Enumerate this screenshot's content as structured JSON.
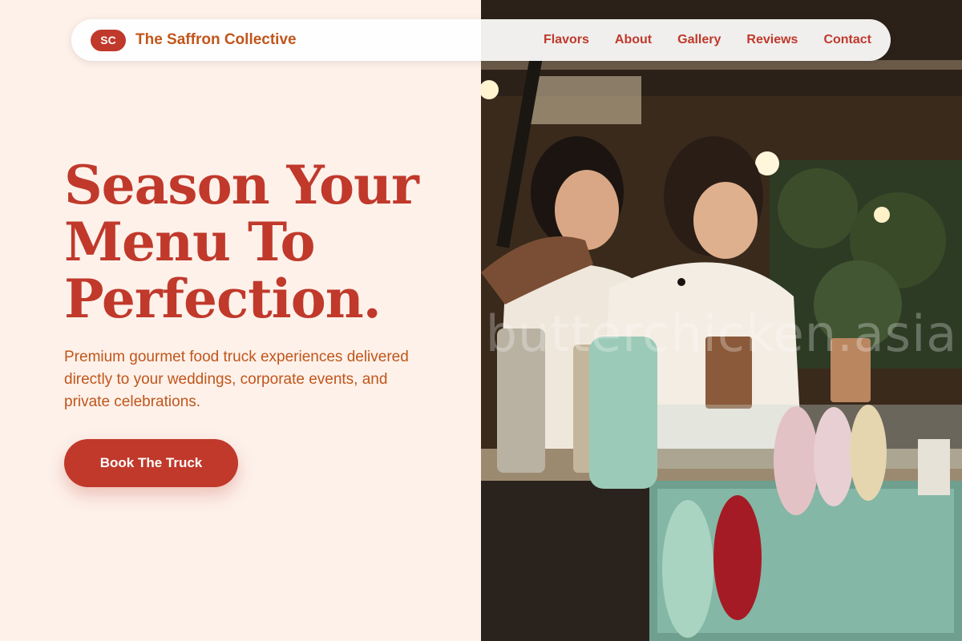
{
  "brand": {
    "logo_text": "SC",
    "name": "The Saffron Collective",
    "accent": "#c0392b",
    "name_color": "#c0561b"
  },
  "nav": {
    "links": [
      "Flavors",
      "About",
      "Gallery",
      "Reviews",
      "Contact"
    ]
  },
  "hero": {
    "title_lines": [
      "Season Your",
      "Menu To",
      "Perfection."
    ],
    "subtitle": "Premium gourmet food truck experiences delivered directly to your weddings, corporate events, and private celebrations.",
    "cta_label": "Book The Truck"
  },
  "image": {
    "watermark": "butterchicken.asia",
    "background": "#fdf1ea"
  }
}
